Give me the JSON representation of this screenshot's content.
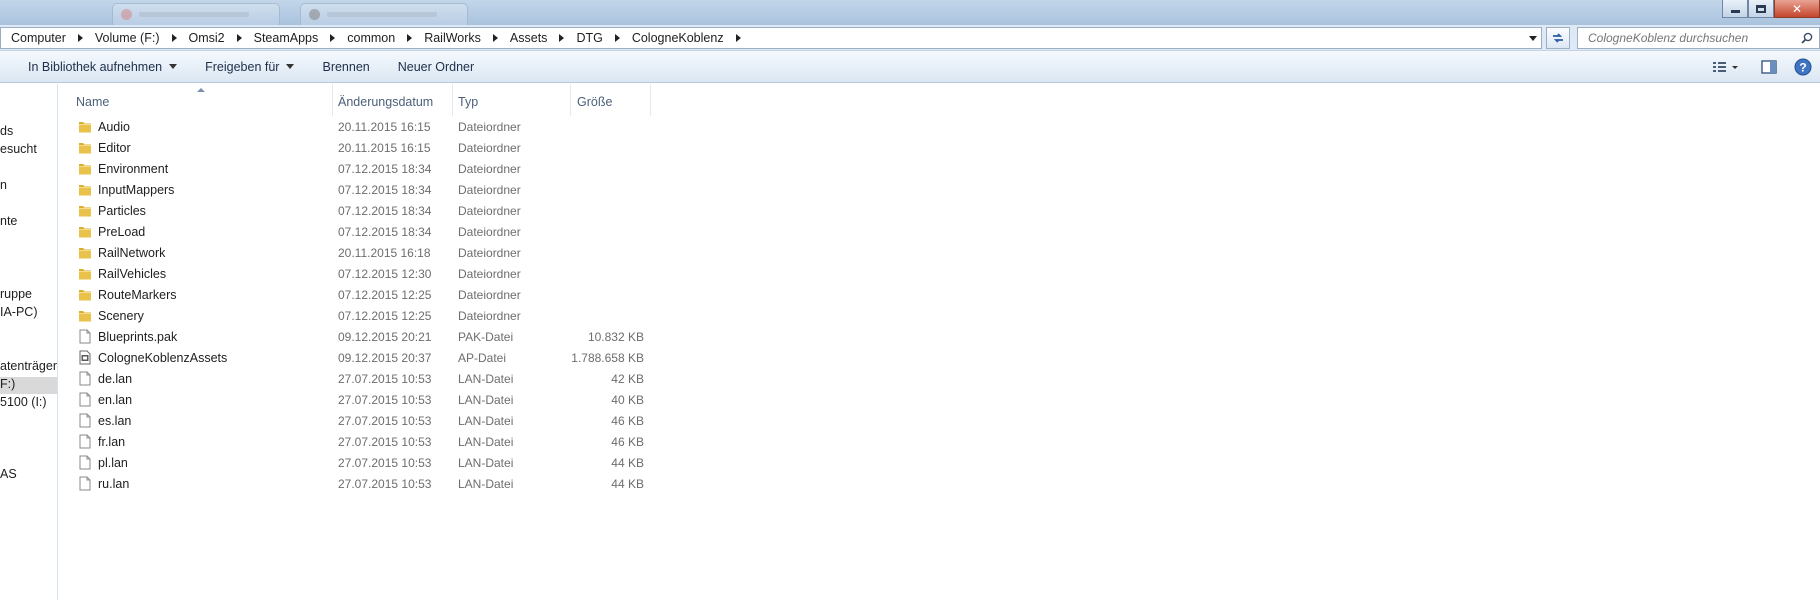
{
  "window": {
    "controls": {
      "minimize": "minimize",
      "maximize": "maximize",
      "close": "close"
    }
  },
  "breadcrumb": [
    "Computer",
    "Volume (F:)",
    "Omsi2",
    "SteamApps",
    "common",
    "RailWorks",
    "Assets",
    "DTG",
    "CologneKoblenz"
  ],
  "search": {
    "placeholder": "CologneKoblenz durchsuchen"
  },
  "toolbar": {
    "library_label": "In Bibliothek aufnehmen",
    "share_label": "Freigeben für",
    "burn_label": "Brennen",
    "new_folder_label": "Neuer Ordner"
  },
  "nav_pane": {
    "items": [
      "ds",
      "esucht",
      "n",
      "nte",
      "ruppe",
      "IA-PC)",
      "atenträger",
      "F:)",
      "5100 (I:)",
      "AS"
    ],
    "selected_index": 7
  },
  "columns": {
    "name": "Name",
    "date": "Änderungsdatum",
    "type": "Typ",
    "size": "Größe"
  },
  "files": [
    {
      "name": "Audio",
      "date": "20.11.2015 16:15",
      "type": "Dateiordner",
      "size": "",
      "icon": "folder-icon"
    },
    {
      "name": "Editor",
      "date": "20.11.2015 16:15",
      "type": "Dateiordner",
      "size": "",
      "icon": "folder-icon"
    },
    {
      "name": "Environment",
      "date": "07.12.2015 18:34",
      "type": "Dateiordner",
      "size": "",
      "icon": "folder-icon"
    },
    {
      "name": "InputMappers",
      "date": "07.12.2015 18:34",
      "type": "Dateiordner",
      "size": "",
      "icon": "folder-icon"
    },
    {
      "name": "Particles",
      "date": "07.12.2015 18:34",
      "type": "Dateiordner",
      "size": "",
      "icon": "folder-icon"
    },
    {
      "name": "PreLoad",
      "date": "07.12.2015 18:34",
      "type": "Dateiordner",
      "size": "",
      "icon": "folder-icon"
    },
    {
      "name": "RailNetwork",
      "date": "20.11.2015 16:18",
      "type": "Dateiordner",
      "size": "",
      "icon": "folder-icon"
    },
    {
      "name": "RailVehicles",
      "date": "07.12.2015 12:30",
      "type": "Dateiordner",
      "size": "",
      "icon": "folder-icon"
    },
    {
      "name": "RouteMarkers",
      "date": "07.12.2015 12:25",
      "type": "Dateiordner",
      "size": "",
      "icon": "folder-icon"
    },
    {
      "name": "Scenery",
      "date": "07.12.2015 12:25",
      "type": "Dateiordner",
      "size": "",
      "icon": "folder-icon"
    },
    {
      "name": "Blueprints.pak",
      "date": "09.12.2015 20:21",
      "type": "PAK-Datei",
      "size": "10.832 KB",
      "icon": "file-icon"
    },
    {
      "name": "CologneKoblenzAssets",
      "date": "09.12.2015 20:37",
      "type": "AP-Datei",
      "size": "1.788.658 KB",
      "icon": "archive-file-icon"
    },
    {
      "name": "de.lan",
      "date": "27.07.2015 10:53",
      "type": "LAN-Datei",
      "size": "42 KB",
      "icon": "file-icon"
    },
    {
      "name": "en.lan",
      "date": "27.07.2015 10:53",
      "type": "LAN-Datei",
      "size": "40 KB",
      "icon": "file-icon"
    },
    {
      "name": "es.lan",
      "date": "27.07.2015 10:53",
      "type": "LAN-Datei",
      "size": "46 KB",
      "icon": "file-icon"
    },
    {
      "name": "fr.lan",
      "date": "27.07.2015 10:53",
      "type": "LAN-Datei",
      "size": "46 KB",
      "icon": "file-icon"
    },
    {
      "name": "pl.lan",
      "date": "27.07.2015 10:53",
      "type": "LAN-Datei",
      "size": "44 KB",
      "icon": "file-icon"
    },
    {
      "name": "ru.lan",
      "date": "27.07.2015 10:53",
      "type": "LAN-Datei",
      "size": "44 KB",
      "icon": "file-icon"
    }
  ],
  "colors": {
    "folder": "#e8c24a",
    "accent": "#2a5ca5",
    "selection": "#d9d9d9"
  }
}
